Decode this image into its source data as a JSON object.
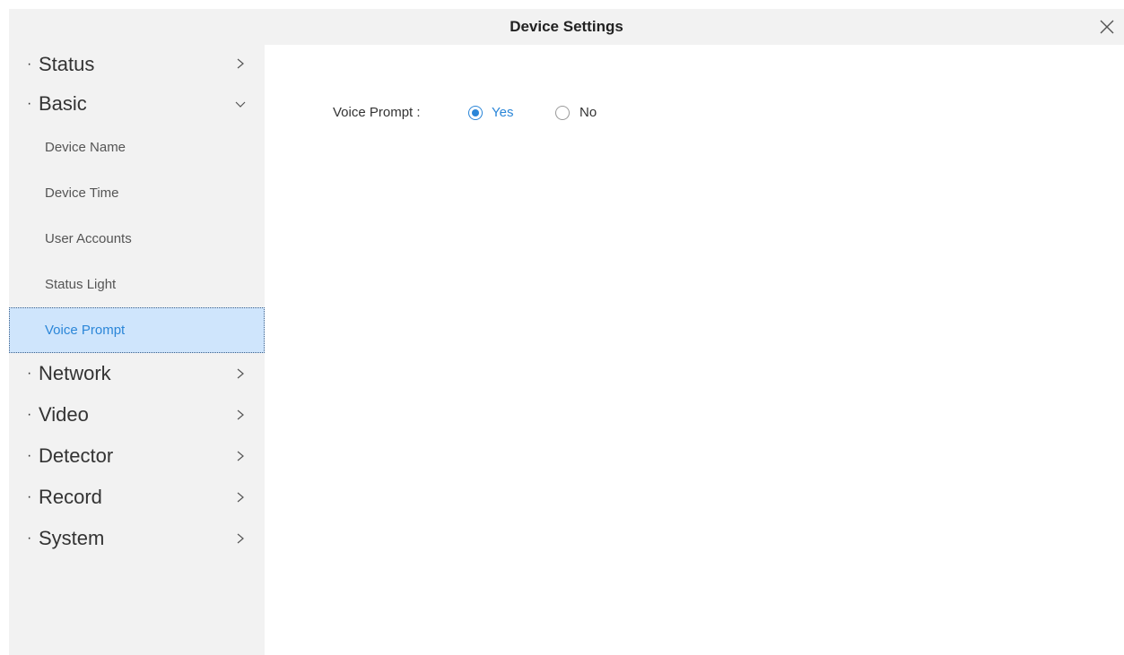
{
  "window": {
    "title": "Device Settings"
  },
  "sidebar": {
    "groups": [
      {
        "label": "Status",
        "expanded": false
      },
      {
        "label": "Basic",
        "expanded": true,
        "items": [
          {
            "label": "Device Name"
          },
          {
            "label": "Device Time"
          },
          {
            "label": "User Accounts"
          },
          {
            "label": "Status Light"
          },
          {
            "label": "Voice Prompt",
            "selected": true
          }
        ]
      },
      {
        "label": "Network",
        "expanded": false
      },
      {
        "label": "Video",
        "expanded": false
      },
      {
        "label": "Detector",
        "expanded": false
      },
      {
        "label": "Record",
        "expanded": false
      },
      {
        "label": "System",
        "expanded": false
      }
    ],
    "bullet": "·"
  },
  "voice_prompt": {
    "label": "Voice Prompt :",
    "options": [
      {
        "label": "Yes",
        "checked": true
      },
      {
        "label": "No",
        "checked": false
      }
    ]
  },
  "icons": {
    "close": "close-icon",
    "collapsed": "chevron-right-icon",
    "expanded": "chevron-down-icon"
  },
  "colors": {
    "accent": "#2b86d8",
    "sidebar_bg": "#f2f2f2",
    "selected_bg": "#cfe5fc"
  }
}
